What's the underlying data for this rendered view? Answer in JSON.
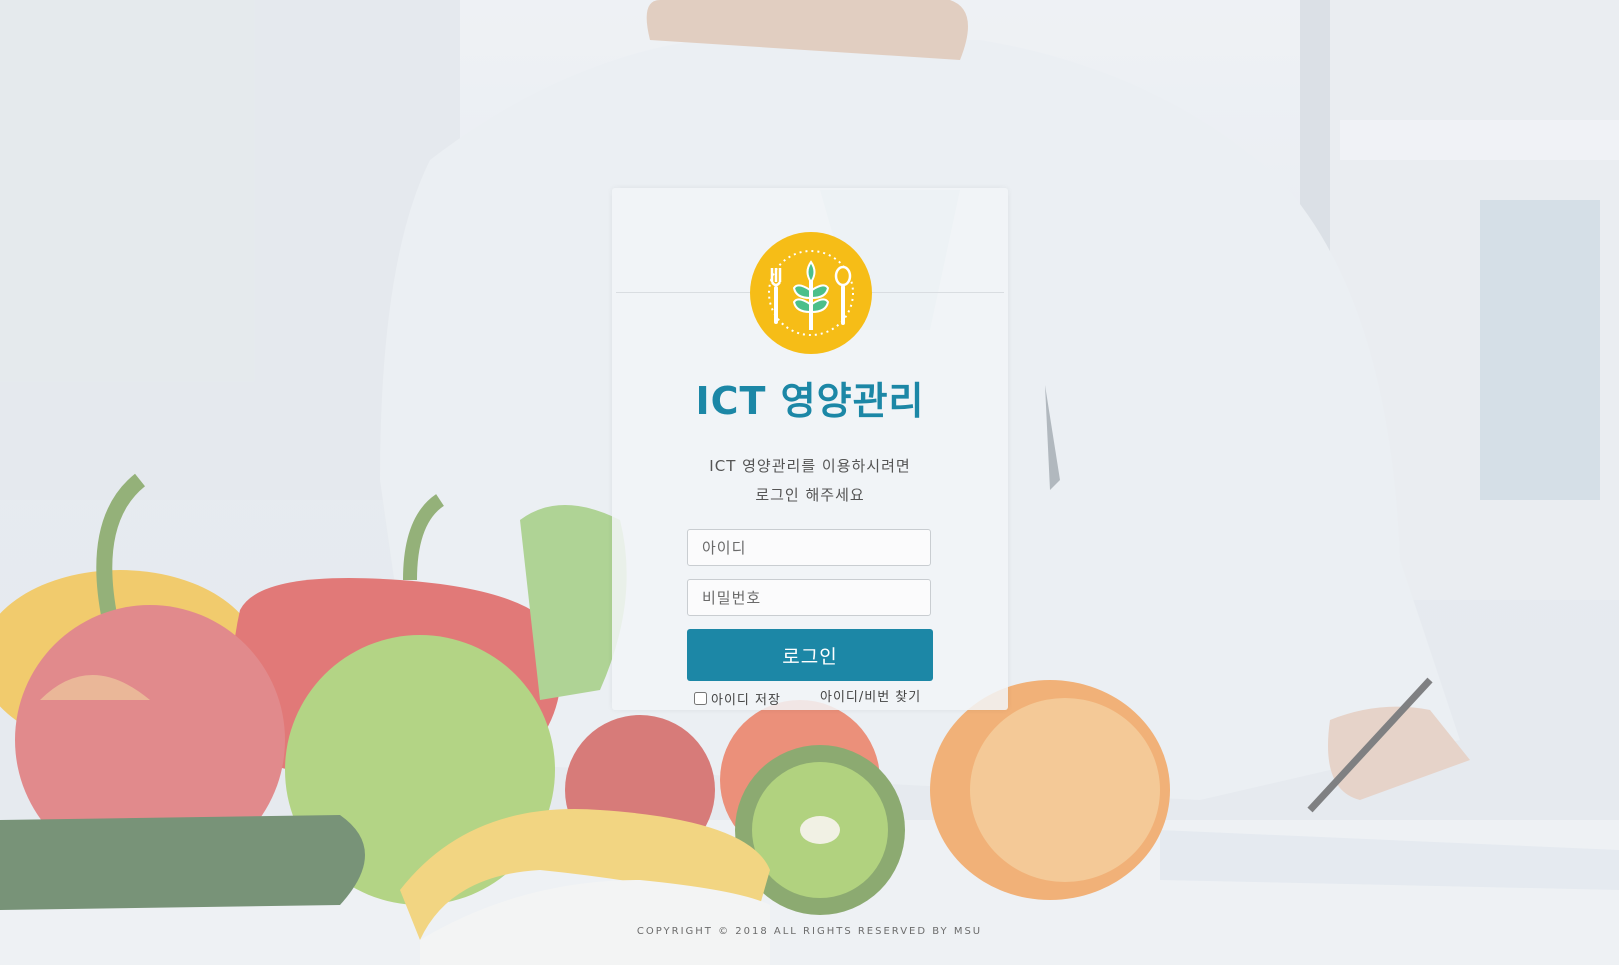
{
  "app": {
    "title": "ICT 영양관리",
    "subtitle_line1": "ICT 영양관리를 이용하시려면",
    "subtitle_line2": "로그인 해주세요",
    "logo_icon": "fork-wheat-spoon-icon"
  },
  "login_form": {
    "id_placeholder": "아이디",
    "id_value": "",
    "password_placeholder": "비밀번호",
    "password_value": "",
    "login_label": "로그인",
    "remember_label": "아이디 저장",
    "remember_checked": false,
    "find_label": "아이디/비번 찾기"
  },
  "footer": {
    "copyright": "COPYRIGHT © 2018 ALL RIGHTS RESERVED BY MSU"
  },
  "colors": {
    "accent": "#1c87a6",
    "logo_bg": "#f6bd17",
    "leaf": "#4cbf8a"
  }
}
